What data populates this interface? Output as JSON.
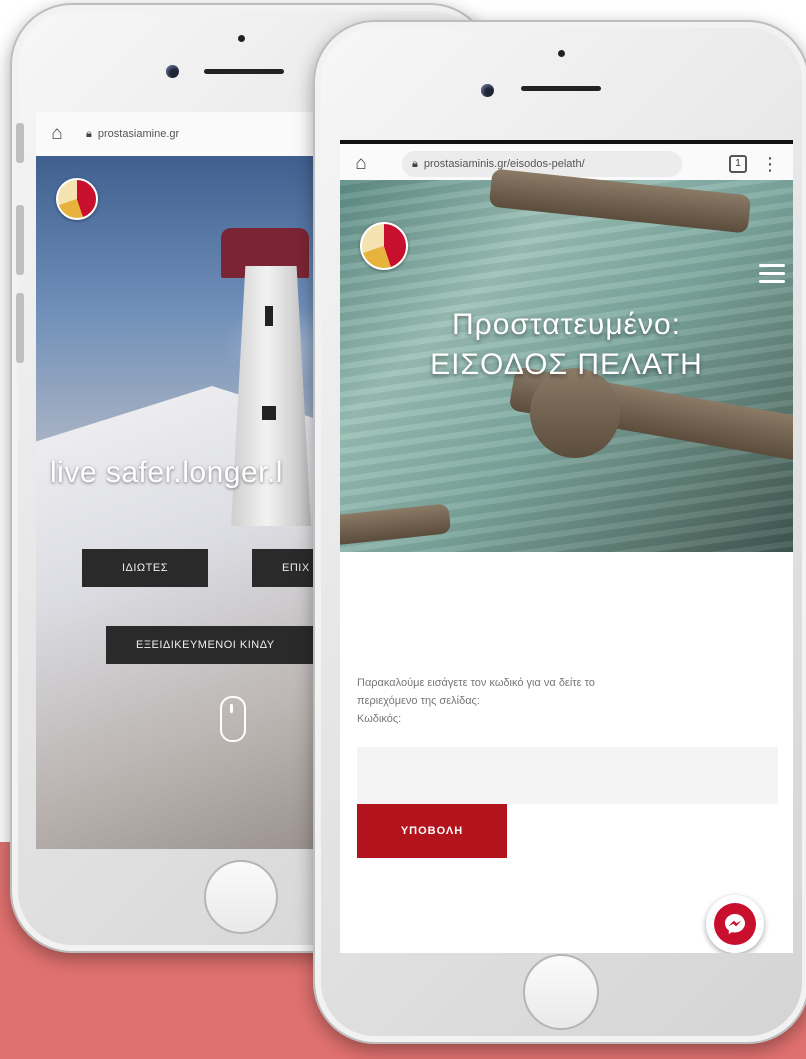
{
  "left_phone": {
    "url": "prostasiamine.gr",
    "tagline": "live safer.longer.l",
    "buttons": [
      "ΙΔΙΩΤΕΣ",
      "ΕΠΙΧ",
      "ΕΞΕΙΔΙΚΕΥΜΕΝΟΙ ΚΙΝΔΥ"
    ]
  },
  "right_phone": {
    "url": "prostasiaminis.gr/eisodos-pelath/",
    "tabs_count": "1",
    "title_line1": "Προστατευμένο:",
    "title_line2": "ΕΙΣΟΔΟΣ ΠΕΛΑΤΗ",
    "form": {
      "instruction_line1": "Παρακαλούμε εισάγετε τον κωδικό για να δείτε το",
      "instruction_line2": "περιεχόμενο της σελίδας:",
      "password_label": "Κωδικός:",
      "submit_label": "ΥΠΟΒΟΛΗ"
    }
  },
  "colors": {
    "band": "#e0716f",
    "brand_red": "#b3131c",
    "dark_button": "#2a2a2a"
  }
}
